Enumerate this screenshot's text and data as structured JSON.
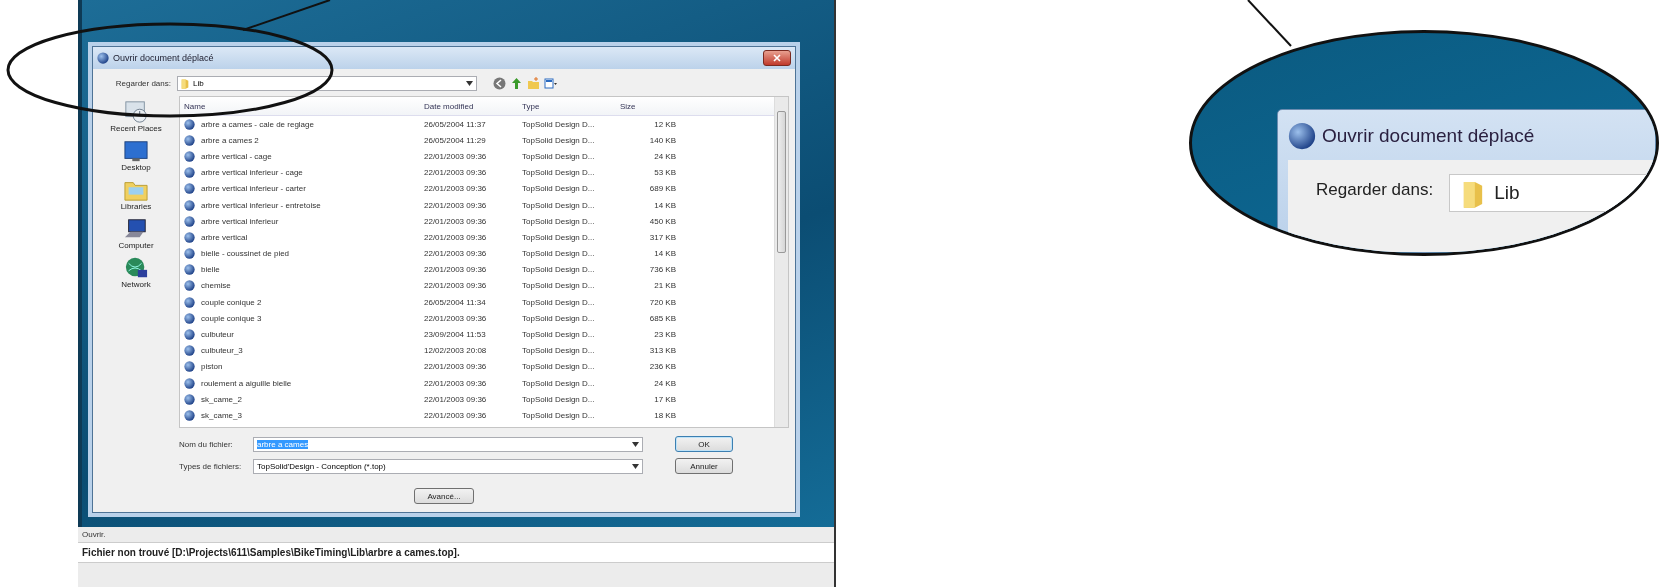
{
  "dialog": {
    "title": "Ouvrir document déplacé",
    "look_in_label": "Regarder dans:",
    "look_in_value": "Lib",
    "places": [
      {
        "kind": "recent",
        "label": "Recent Places"
      },
      {
        "kind": "desktop",
        "label": "Desktop"
      },
      {
        "kind": "libraries",
        "label": "Libraries"
      },
      {
        "kind": "computer",
        "label": "Computer"
      },
      {
        "kind": "network",
        "label": "Network"
      }
    ],
    "columns": [
      "Name",
      "Date modified",
      "Type",
      "Size"
    ],
    "rows": [
      {
        "name": "arbre a cames - cale de reglage",
        "date": "26/05/2004 11:37",
        "type": "TopSolid Design D...",
        "size": "12 KB"
      },
      {
        "name": "arbre a cames 2",
        "date": "26/05/2004 11:29",
        "type": "TopSolid Design D...",
        "size": "140 KB"
      },
      {
        "name": "arbre vertical - cage",
        "date": "22/01/2003 09:36",
        "type": "TopSolid Design D...",
        "size": "24 KB"
      },
      {
        "name": "arbre vertical inferieur - cage",
        "date": "22/01/2003 09:36",
        "type": "TopSolid Design D...",
        "size": "53 KB"
      },
      {
        "name": "arbre vertical inferieur - carter",
        "date": "22/01/2003 09:36",
        "type": "TopSolid Design D...",
        "size": "689 KB"
      },
      {
        "name": "arbre vertical inferieur - entretoise",
        "date": "22/01/2003 09:36",
        "type": "TopSolid Design D...",
        "size": "14 KB"
      },
      {
        "name": "arbre vertical inferieur",
        "date": "22/01/2003 09:36",
        "type": "TopSolid Design D...",
        "size": "450 KB"
      },
      {
        "name": "arbre vertical",
        "date": "22/01/2003 09:36",
        "type": "TopSolid Design D...",
        "size": "317 KB"
      },
      {
        "name": "bielle - coussinet de pied",
        "date": "22/01/2003 09:36",
        "type": "TopSolid Design D...",
        "size": "14 KB"
      },
      {
        "name": "bielle",
        "date": "22/01/2003 09:36",
        "type": "TopSolid Design D...",
        "size": "736 KB"
      },
      {
        "name": "chemise",
        "date": "22/01/2003 09:36",
        "type": "TopSolid Design D...",
        "size": "21 KB"
      },
      {
        "name": "couple conique 2",
        "date": "26/05/2004 11:34",
        "type": "TopSolid Design D...",
        "size": "720 KB"
      },
      {
        "name": "couple conique 3",
        "date": "22/01/2003 09:36",
        "type": "TopSolid Design D...",
        "size": "685 KB"
      },
      {
        "name": "culbuteur",
        "date": "23/09/2004 11:53",
        "type": "TopSolid Design D...",
        "size": "23 KB"
      },
      {
        "name": "culbuteur_3",
        "date": "12/02/2003 20:08",
        "type": "TopSolid Design D...",
        "size": "313 KB"
      },
      {
        "name": "piston",
        "date": "22/01/2003 09:36",
        "type": "TopSolid Design D...",
        "size": "236 KB"
      },
      {
        "name": "roulement a aiguille bielle",
        "date": "22/01/2003 09:36",
        "type": "TopSolid Design D...",
        "size": "24 KB"
      },
      {
        "name": "sk_came_2",
        "date": "22/01/2003 09:36",
        "type": "TopSolid Design D...",
        "size": "17 KB"
      },
      {
        "name": "sk_came_3",
        "date": "22/01/2003 09:36",
        "type": "TopSolid Design D...",
        "size": "18 KB"
      }
    ],
    "file_name_label": "Nom du fichier:",
    "file_name": {
      "value": "arbre a cames",
      "text_selected": true
    },
    "file_type_label": "Types de fichiers:",
    "file_type_value": "TopSolid'Design - Conception (*.top)",
    "buttons": [
      {
        "label": "OK",
        "default": true
      },
      {
        "label": "Annuler",
        "default": false
      }
    ],
    "advanced_button": "Avancé..."
  },
  "status": {
    "label": "Ouvrir.",
    "message": "Fichier non trouvé [D:\\Projects\\611\\Samples\\BikeTiming\\Lib\\arbre a cames.top]."
  },
  "inset": {
    "title": "Ouvrir document déplacé",
    "look_in_label": "Regarder dans:",
    "look_in_value": "Lib"
  }
}
